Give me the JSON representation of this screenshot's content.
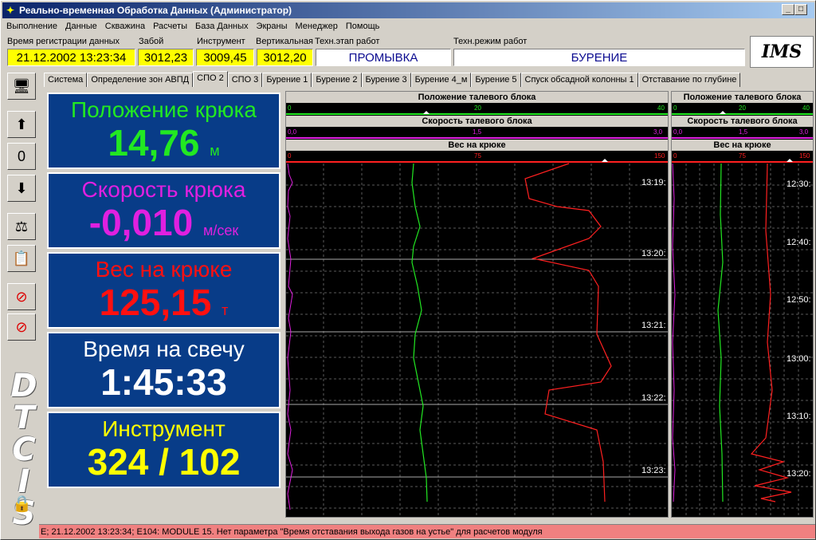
{
  "window": {
    "title": "Реально-временная Обработка Данных (Администратор)"
  },
  "menu": [
    "Выполнение",
    "Данные",
    "Скважина",
    "Расчеты",
    "База Данных",
    "Экраны",
    "Менеджер",
    "Помощь"
  ],
  "status": {
    "time_label": "Время регистрации данных",
    "time_value": "21.12.2002 13:23:34",
    "bottom_label": "Забой",
    "bottom_value": "3012,23",
    "tool_label": "Инструмент",
    "tool_value": "3009,45",
    "vertical_label": "Вертикальная",
    "vertical_value": "3012,20",
    "stage_label": "Техн.этап работ",
    "stage_value": "ПРОМЫВКА",
    "mode_label": "Техн.режим работ",
    "mode_value": "БУРЕНИЕ"
  },
  "logo_text": "IMS",
  "side_text": "DTCIS",
  "tabs": [
    "Система",
    "Определение зон АВПД",
    "СПО 2",
    "СПО 3",
    "Бурение 1",
    "Бурение 2",
    "Бурение 3",
    "Бурение 4_м",
    "Бурение 5",
    "Спуск обсадной колонны 1",
    "Отставание по глубине"
  ],
  "active_tab": "СПО 2",
  "panels": [
    {
      "title": "Положение крюка",
      "value": "14,76",
      "unit": "м",
      "color": "#22e822"
    },
    {
      "title": "Скорость крюка",
      "value": "-0,010",
      "unit": "м/сек",
      "color": "#e020e0"
    },
    {
      "title": "Вес на крюке",
      "value": "125,15",
      "unit": "т",
      "color": "#ff1010"
    },
    {
      "title": "Время на свечу",
      "value": "1:45:33",
      "unit": "",
      "color": "#ffffff"
    },
    {
      "title": "Инструмент",
      "value": "324 / 102",
      "unit": "",
      "color": "#ffff00"
    }
  ],
  "chartA": {
    "h1": "Положение талевого блока",
    "s1": [
      "0",
      "20",
      "40"
    ],
    "h2": "Скорость талевого блока",
    "s2": [
      "0,0",
      "1,5",
      "3,0"
    ],
    "h3": "Вес на крюке",
    "s3": [
      "0",
      "75",
      "150"
    ],
    "times": [
      "13:19:",
      "13:20:",
      "13:21:",
      "13:22:",
      "13:23:"
    ]
  },
  "chartB": {
    "h1": "Положение талевого блока",
    "s1": [
      "0",
      "20",
      "40"
    ],
    "h2": "Скорость талевого блока",
    "s2": [
      "0,0",
      "1,5",
      "3,0"
    ],
    "h3": "Вес на крюке",
    "s3": [
      "0",
      "75",
      "150"
    ],
    "times": [
      "12:30:",
      "12:40:",
      "12:50:",
      "13:00:",
      "13:10:",
      "13:20:"
    ]
  },
  "statusbar": "E; 21.12.2002 13:23:34; E104: MODULE 15. Нет параметра  \"Время отставания выхода газов на устье\" для расчетов модуля",
  "colors": {
    "green": "#22e822",
    "magenta": "#e020e0",
    "red": "#ff2020"
  }
}
